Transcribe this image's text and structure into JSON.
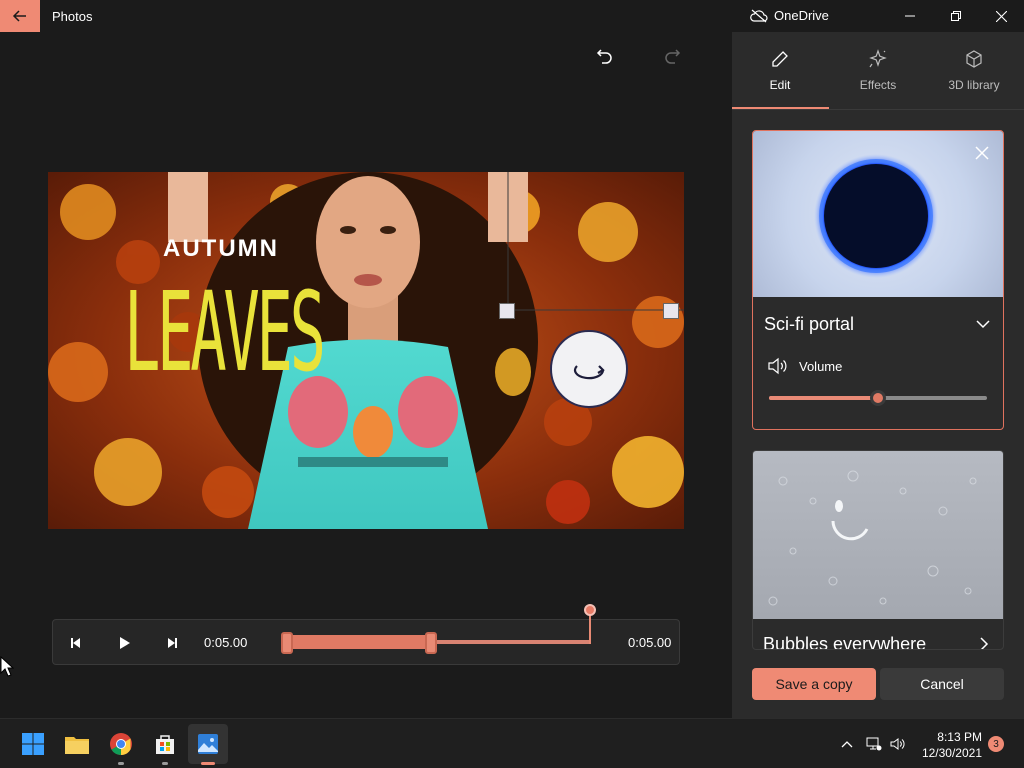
{
  "titlebar": {
    "app_name": "Photos",
    "cloud_label": "OneDrive"
  },
  "preview": {
    "title_line1": "AUTUMN",
    "title_line2": "LEAVES"
  },
  "timeline": {
    "start_time": "0:05.00",
    "end_time": "0:05.00"
  },
  "panel": {
    "tabs": [
      {
        "label": "Edit",
        "icon": "pencil-icon",
        "active": true
      },
      {
        "label": "Effects",
        "icon": "sparkle-icon",
        "active": false
      },
      {
        "label": "3D library",
        "icon": "cube-icon",
        "active": false
      }
    ],
    "effects": [
      {
        "name": "Sci-fi portal",
        "volume_label": "Volume",
        "volume_fraction": 0.5
      },
      {
        "name": "Bubbles everywhere"
      }
    ],
    "save_label": "Save a copy",
    "cancel_label": "Cancel"
  },
  "taskbar": {
    "apps": [
      "windows-start-icon",
      "file-explorer-icon",
      "chrome-icon",
      "microsoft-store-icon",
      "photos-icon"
    ],
    "time": "8:13 PM",
    "date": "12/30/2021",
    "notification_count": "3"
  },
  "colors": {
    "accent": "#ef8a74",
    "background": "#1b1b1b",
    "panel": "#2b2b2b"
  }
}
